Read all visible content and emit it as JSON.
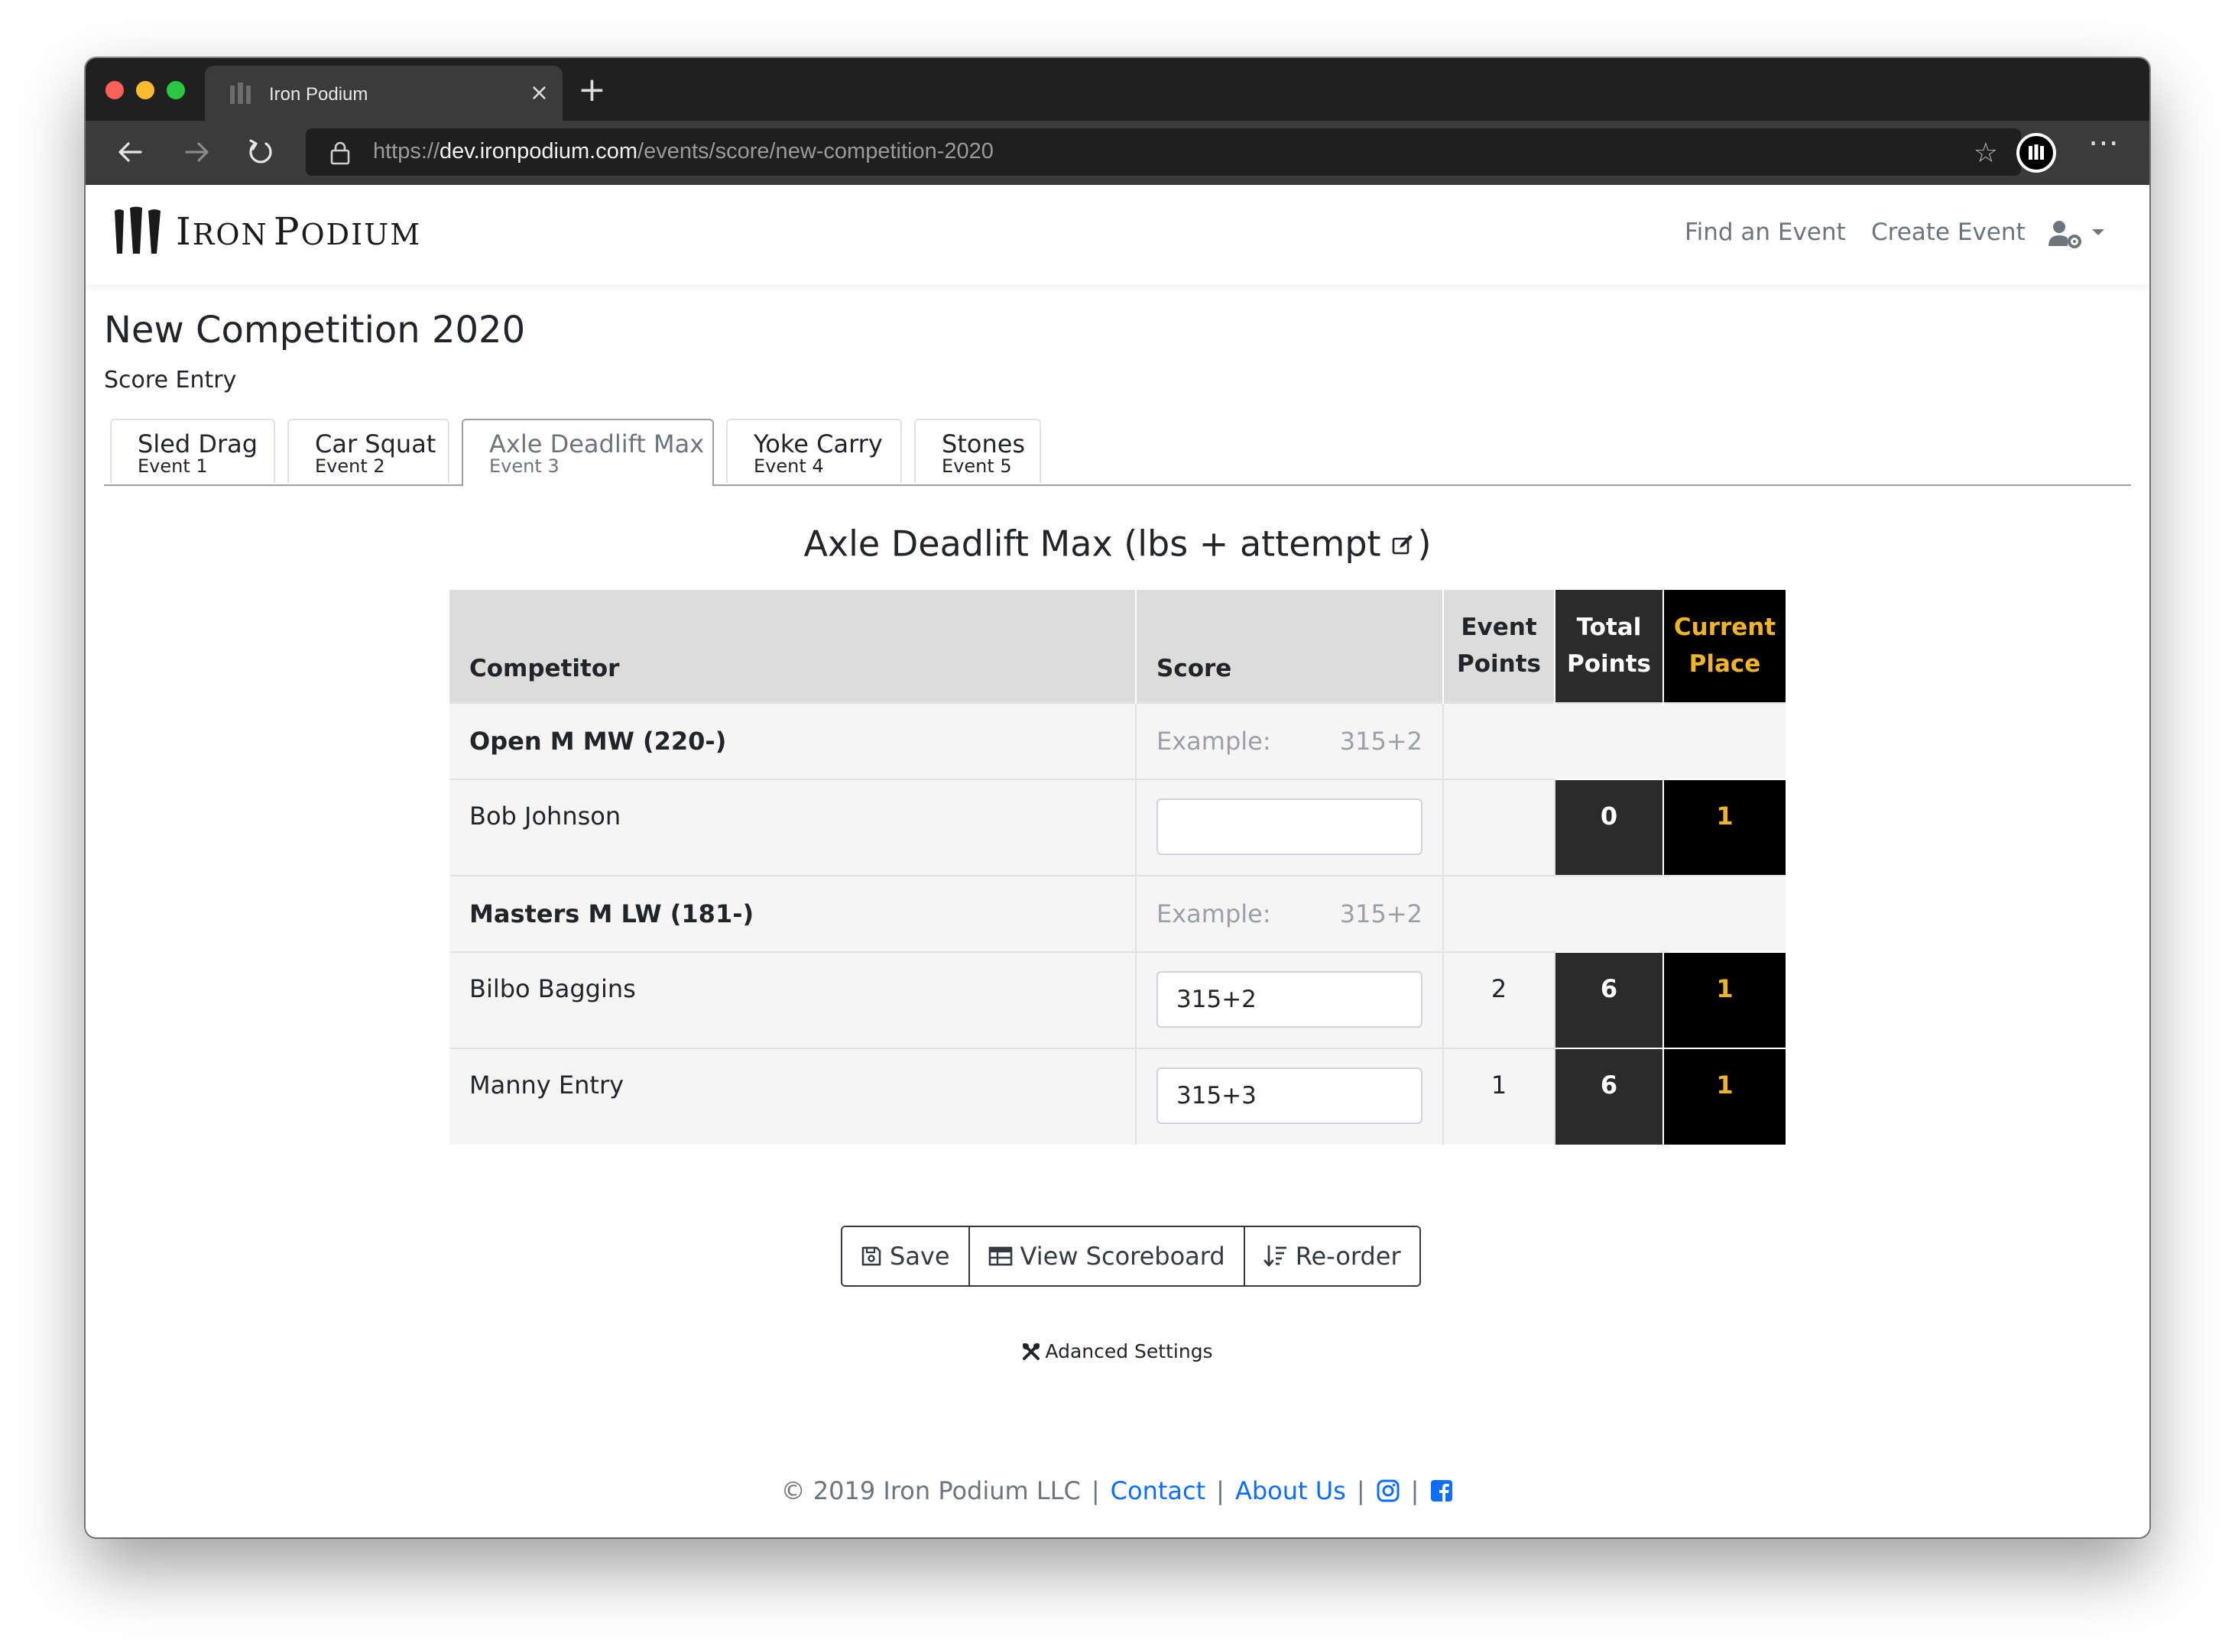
{
  "browser": {
    "tab_title": "Iron Podium",
    "url_scheme": "https://",
    "url_host": "dev.ironpodium.com",
    "url_path": "/events/score/new-competition-2020"
  },
  "navbar": {
    "brand_first_initial": "I",
    "brand_first_rest": "RON",
    "brand_second_initial": "P",
    "brand_second_rest": "ODIUM",
    "find_event": "Find an Event",
    "create_event": "Create Event"
  },
  "page": {
    "title": "New Competition 2020",
    "subtitle": "Score Entry"
  },
  "event_tabs": [
    {
      "name": "Sled Drag",
      "sub": "Event 1"
    },
    {
      "name": "Car Squat",
      "sub": "Event 2"
    },
    {
      "name": "Axle Deadlift Max",
      "sub": "Event 3"
    },
    {
      "name": "Yoke Carry",
      "sub": "Event 4"
    },
    {
      "name": "Stones",
      "sub": "Event 5"
    }
  ],
  "event_heading": {
    "name": "Axle Deadlift Max (lbs + attempt",
    "close": ")"
  },
  "table": {
    "headers": {
      "competitor": "Competitor",
      "score": "Score",
      "event_points_1": "Event",
      "event_points_2": "Points",
      "total_points_1": "Total",
      "total_points_2": "Points",
      "current_place_1": "Current",
      "current_place_2": "Place"
    },
    "groups": [
      {
        "name": "Open M MW (220-)",
        "example_label": "Example:",
        "example_value": "315+2",
        "athletes": [
          {
            "name": "Bob Johnson",
            "score": "",
            "event_points": "",
            "total_points": "0",
            "current_place": "1"
          }
        ]
      },
      {
        "name": "Masters M LW (181-)",
        "example_label": "Example:",
        "example_value": "315+2",
        "athletes": [
          {
            "name": "Bilbo Baggins",
            "score": "315+2",
            "event_points": "2",
            "total_points": "6",
            "current_place": "1"
          },
          {
            "name": "Manny Entry",
            "score": "315+3",
            "event_points": "1",
            "total_points": "6",
            "current_place": "1"
          }
        ]
      }
    ]
  },
  "buttons": {
    "save": "Save",
    "view_scoreboard": "View Scoreboard",
    "reorder": "Re-order"
  },
  "advanced_settings": "Adanced Settings",
  "footer": {
    "copyright": "© 2019 Iron Podium LLC",
    "contact": "Contact",
    "about": "About Us",
    "sep": "|"
  },
  "icons": {
    "close_tab": "×",
    "new_tab": "+",
    "star": "☆",
    "more": "⋯"
  },
  "colors": {
    "place_gold": "#f0b429",
    "link_blue": "#0d6efd"
  }
}
